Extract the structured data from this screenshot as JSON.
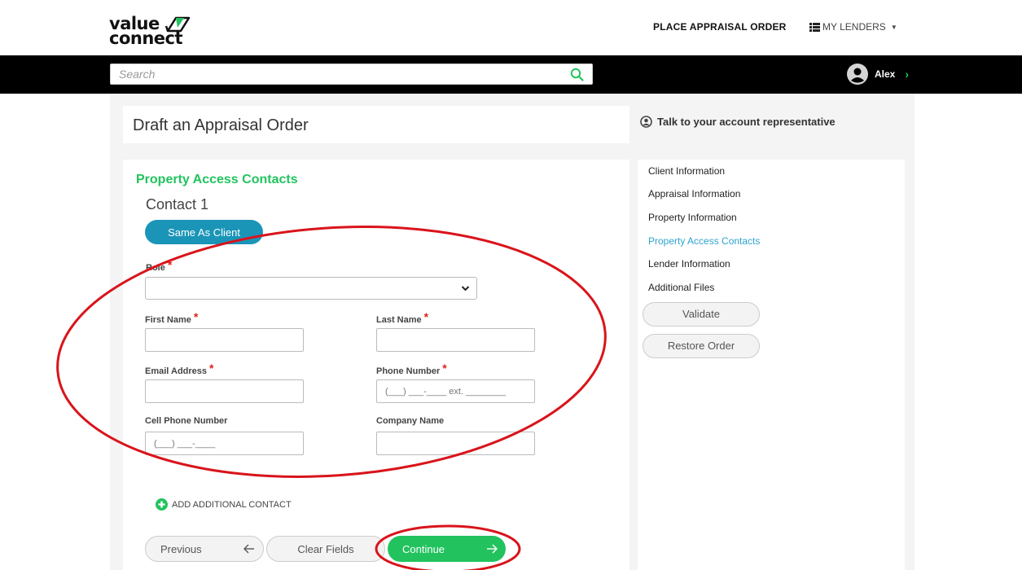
{
  "header": {
    "logo": {
      "line1": "value",
      "line2": "connect"
    },
    "place_order": "PLACE APPRAISAL ORDER",
    "my_lenders": "MY LENDERS"
  },
  "search": {
    "placeholder": "Search"
  },
  "user": {
    "name": "Alex"
  },
  "page": {
    "title": "Draft an Appraisal Order",
    "rep_link": "Talk to your account representative"
  },
  "form": {
    "section_title": "Property Access Contacts",
    "contact_title": "Contact 1",
    "same_as_client": "Same As Client",
    "role_label": "Role",
    "first_name_label": "First Name",
    "last_name_label": "Last Name",
    "email_label": "Email Address",
    "phone_label": "Phone Number",
    "phone_placeholder": "(___) ___-____ ext. ________",
    "cell_label": "Cell Phone Number",
    "cell_placeholder": "(___) ___-____",
    "company_label": "Company Name",
    "add_contact": "ADD ADDITIONAL CONTACT"
  },
  "buttons": {
    "previous": "Previous",
    "clear": "Clear Fields",
    "continue": "Continue"
  },
  "sidebar": {
    "items": [
      {
        "label": "Client Information"
      },
      {
        "label": "Appraisal Information"
      },
      {
        "label": "Property Information"
      },
      {
        "label": "Property Access Contacts"
      },
      {
        "label": "Lender Information"
      },
      {
        "label": "Additional Files"
      }
    ],
    "validate": "Validate",
    "restore": "Restore Order"
  },
  "colors": {
    "brand_green": "#22c35e",
    "accent_blue": "#1a95b8",
    "active_link": "#2ea3d0",
    "required": "#e0201b",
    "annotation": "#d9141b"
  }
}
